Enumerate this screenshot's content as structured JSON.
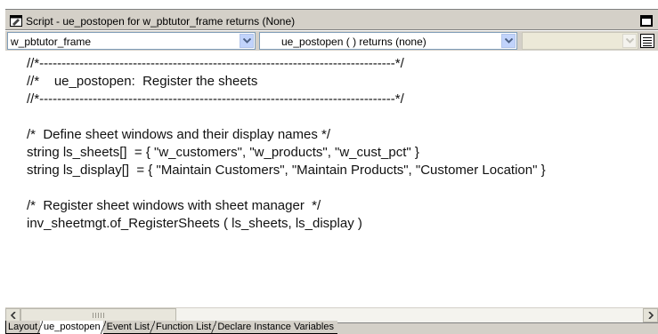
{
  "window": {
    "title": "Script - ue_postopen for w_pbtutor_frame returns (None)"
  },
  "dropdowns": {
    "object": {
      "value": "w_pbtutor_frame"
    },
    "event": {
      "value": "ue_postopen ( ) returns (none)"
    },
    "ancestor": {
      "value": ""
    }
  },
  "code_lines": [
    "//*--------------------------------------------------------------------------------*/",
    "//*    ue_postopen:  Register the sheets",
    "//*--------------------------------------------------------------------------------*/",
    "",
    "/*  Define sheet windows and their display names */",
    "string ls_sheets[]  = { \"w_customers\", \"w_products\", \"w_cust_pct\" }",
    "string ls_display[]  = { \"Maintain Customers\", \"Maintain Products\", \"Customer Location\" }",
    "",
    "/*  Register sheet windows with sheet manager  */",
    "inv_sheetmgt.of_RegisterSheets ( ls_sheets, ls_display )"
  ],
  "tabs": [
    {
      "label": "Layout",
      "active": false
    },
    {
      "label": "ue_postopen",
      "active": true
    },
    {
      "label": "Event List",
      "active": false
    },
    {
      "label": "Function List",
      "active": false
    },
    {
      "label": "Declare Instance Variables",
      "active": false
    }
  ],
  "icons": {
    "title": "script-icon",
    "maximize": "maximize-icon",
    "list": "list-icon",
    "scroll_left": "scroll-left-arrow-icon",
    "scroll_right": "scroll-right-arrow-icon"
  }
}
